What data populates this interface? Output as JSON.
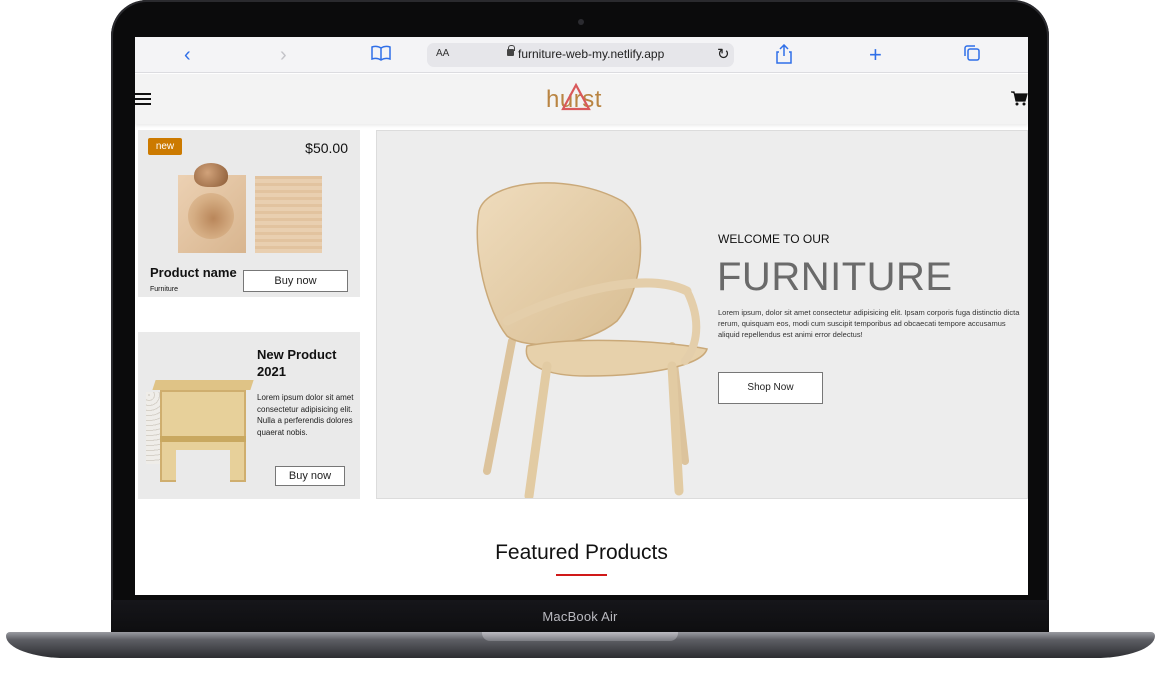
{
  "browser": {
    "url": "furniture-web-my.netlify.app",
    "text_size_label": "AA",
    "icons": [
      "back-icon",
      "forward-icon",
      "bookmarks-icon",
      "lock-icon",
      "reload-icon",
      "share-icon",
      "new-tab-icon",
      "tabs-icon"
    ]
  },
  "site": {
    "brand": "hurst",
    "brand_color": "#b98442",
    "accent_color": "#d01919"
  },
  "product_card": {
    "badge": "new",
    "price": "$50.00",
    "name": "Product name",
    "category": "Furniture",
    "buy_label": "Buy now"
  },
  "new_product_card": {
    "title": "New Product 2021",
    "description": "Lorem ipsum dolor sit amet consectetur adipisicing elit. Nulla a perferendis dolores quaerat nobis.",
    "buy_label": "Buy now"
  },
  "hero": {
    "welcome": "WELCOME TO OUR",
    "title": "FURNITURE",
    "description": "Lorem ipsum, dolor sit amet consectetur adipisicing elit. Ipsam corporis fuga distinctio dicta rerum, quisquam eos, modi cum suscipit temporibus ad obcaecati tempore accusamus aliquid repellendus est animi error delectus!",
    "cta_label": "Shop Now"
  },
  "featured": {
    "title": "Featured Products"
  },
  "device": {
    "model_label": "MacBook Air"
  }
}
